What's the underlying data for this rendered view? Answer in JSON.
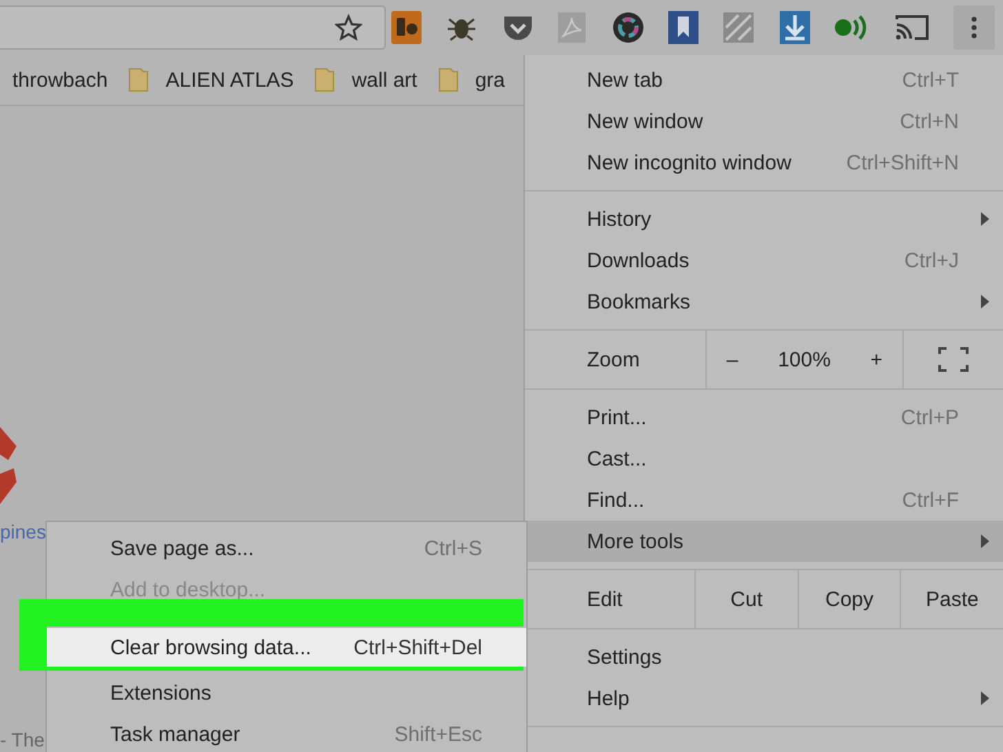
{
  "bookmarks": [
    {
      "label": "throwbach",
      "kind": "link"
    },
    {
      "label": "ALIEN ATLAS",
      "kind": "folder"
    },
    {
      "label": "wall art",
      "kind": "folder"
    },
    {
      "label": "gra",
      "kind": "folder"
    }
  ],
  "page": {
    "link_text": "pines",
    "footer_text": "- The"
  },
  "menu": {
    "groups": [
      {
        "items": [
          {
            "kind": "item",
            "label": "New tab",
            "shortcut": "Ctrl+T",
            "submenu": false,
            "selected": false
          },
          {
            "kind": "item",
            "label": "New window",
            "shortcut": "Ctrl+N",
            "submenu": false,
            "selected": false
          },
          {
            "kind": "item",
            "label": "New incognito window",
            "shortcut": "Ctrl+Shift+N",
            "submenu": false,
            "selected": false
          }
        ]
      },
      {
        "items": [
          {
            "kind": "item",
            "label": "History",
            "submenu": true,
            "selected": false
          },
          {
            "kind": "item",
            "label": "Downloads",
            "shortcut": "Ctrl+J",
            "submenu": false,
            "selected": false
          },
          {
            "kind": "item",
            "label": "Bookmarks",
            "submenu": true,
            "selected": false
          }
        ]
      },
      {
        "items": [
          {
            "kind": "zoom",
            "label": "Zoom",
            "minus": "–",
            "value": "100%",
            "plus": "+"
          }
        ]
      },
      {
        "items": [
          {
            "kind": "item",
            "label": "Print...",
            "shortcut": "Ctrl+P",
            "submenu": false,
            "selected": false
          },
          {
            "kind": "item",
            "label": "Cast...",
            "submenu": false,
            "selected": false
          },
          {
            "kind": "item",
            "label": "Find...",
            "shortcut": "Ctrl+F",
            "submenu": false,
            "selected": false
          },
          {
            "kind": "item",
            "label": "More tools",
            "submenu": true,
            "selected": true
          }
        ]
      },
      {
        "items": [
          {
            "kind": "edit",
            "label": "Edit",
            "buttons": [
              "Cut",
              "Copy",
              "Paste"
            ]
          }
        ]
      },
      {
        "items": [
          {
            "kind": "item",
            "label": "Settings",
            "submenu": false,
            "selected": false
          },
          {
            "kind": "item",
            "label": "Help",
            "submenu": true,
            "selected": false
          }
        ]
      }
    ]
  },
  "submenu": {
    "items": [
      {
        "label": "Save page as...",
        "shortcut": "Ctrl+S",
        "disabled": false,
        "selected": false
      },
      {
        "label": "Add to desktop...",
        "disabled": true,
        "selected": false
      },
      {
        "label": "Clear browsing data...",
        "shortcut": "Ctrl+Shift+Del",
        "disabled": false,
        "selected": true
      },
      {
        "label": "Extensions",
        "disabled": false,
        "selected": false
      },
      {
        "label": "Task manager",
        "shortcut": "Shift+Esc",
        "disabled": false,
        "selected": false
      }
    ]
  }
}
